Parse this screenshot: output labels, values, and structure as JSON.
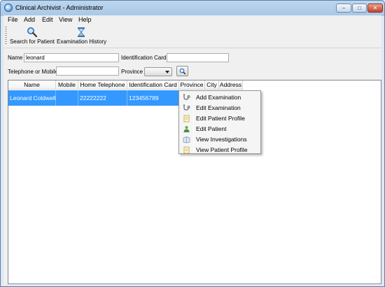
{
  "window": {
    "title": "Clinical Archivist - Administrator"
  },
  "menu": [
    "File",
    "Add",
    "Edit",
    "View",
    "Help"
  ],
  "toolbar": [
    {
      "label": "Search for Patient",
      "icon": "magnifier-icon"
    },
    {
      "label": "Examination History",
      "icon": "hourglass-icon"
    }
  ],
  "form": {
    "name_label": "Name",
    "name_value": "leonard",
    "id_card_label": "Identification Card",
    "id_card_value": "",
    "phone_label": "Telephone or Mobile",
    "phone_value": "",
    "province_label": "Province",
    "province_value": ""
  },
  "table": {
    "columns": [
      "Name",
      "Mobile",
      "Home Telephone",
      "Identification Card",
      "Province",
      "City",
      "Address"
    ],
    "rows": [
      [
        "Leonard Coldwell",
        "",
        "22222222",
        "123456789",
        "",
        "",
        ""
      ]
    ],
    "selection_color": "#3399ff"
  },
  "context_menu": {
    "items": [
      {
        "label": "Add Examination",
        "icon": "stethoscope-icon"
      },
      {
        "label": "Edit Examination",
        "icon": "stethoscope-icon"
      },
      {
        "label": "Edit Patient Profile",
        "icon": "document-icon"
      },
      {
        "label": "Edit Patient",
        "icon": "person-icon"
      },
      {
        "label": "View Investigations",
        "icon": "book-icon"
      },
      {
        "label": "View Patient Profile",
        "icon": "document-icon"
      }
    ]
  }
}
